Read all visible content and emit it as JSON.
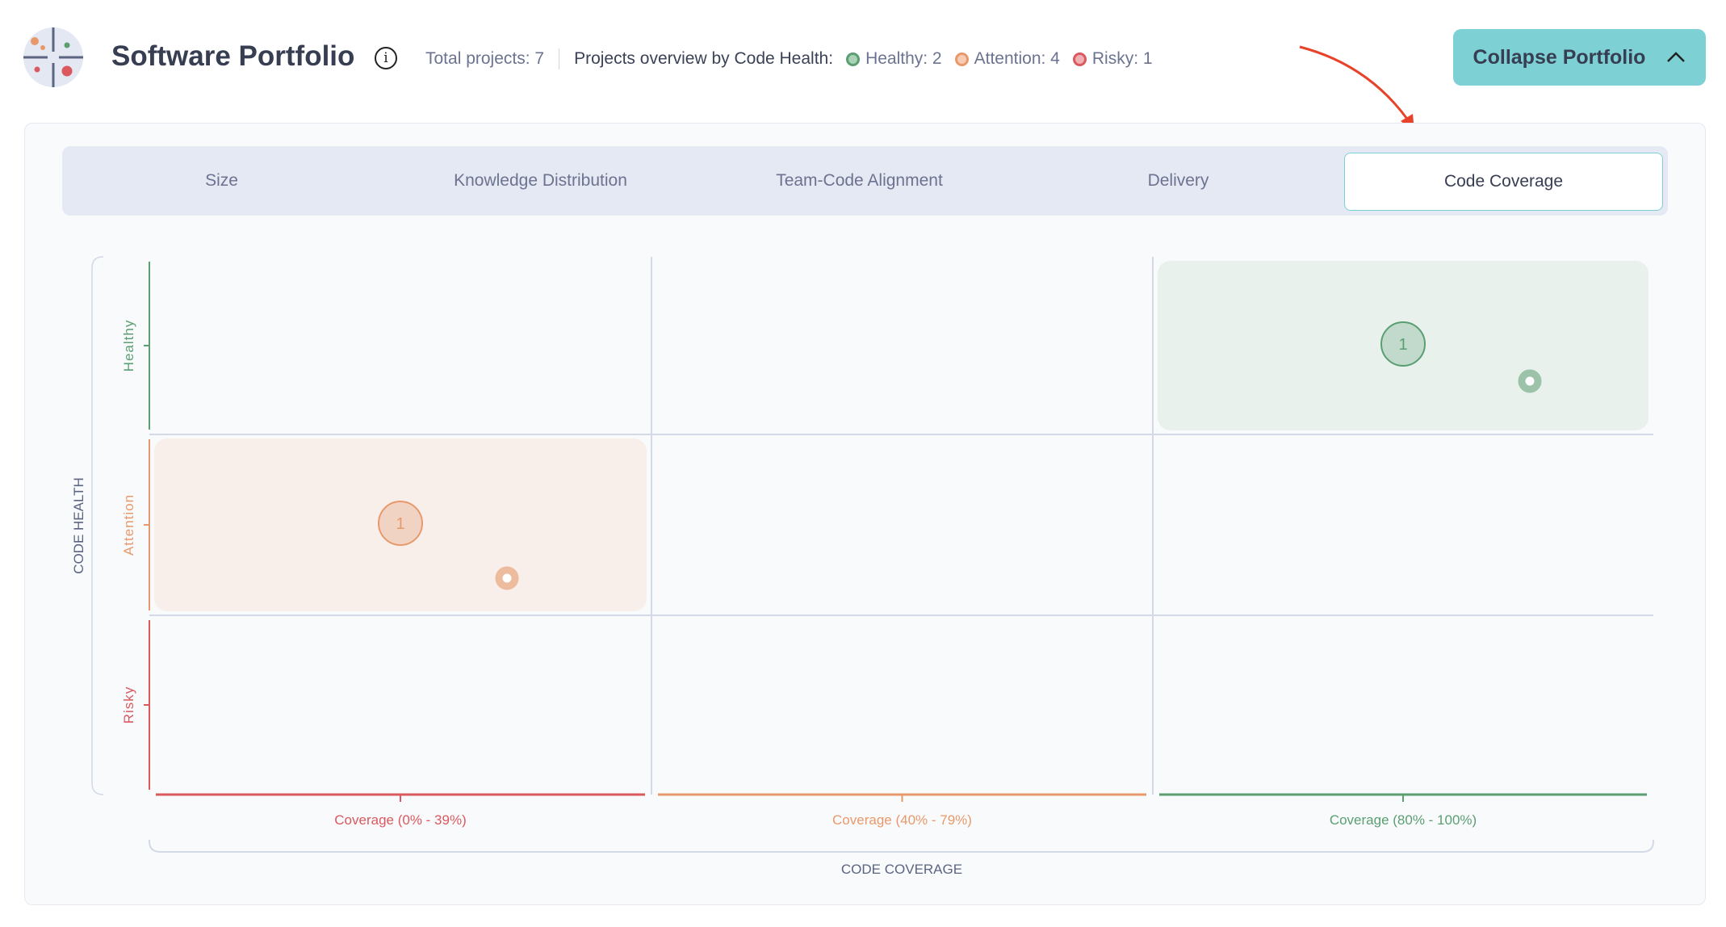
{
  "header": {
    "title": "Software Portfolio",
    "info_icon": "info-circle-icon",
    "total_projects": "Total projects: 7",
    "overview_label": "Projects overview by Code Health:",
    "health_counts": [
      {
        "label": "Healthy: 2",
        "color": "#5a9e72"
      },
      {
        "label": "Attention: 4",
        "color": "#e8996b"
      },
      {
        "label": "Risky: 1",
        "color": "#d9595f"
      }
    ],
    "collapse_button": "Collapse Portfolio",
    "collapse_icon": "chevron-up-icon"
  },
  "tabs": [
    {
      "label": "Size",
      "active": false
    },
    {
      "label": "Knowledge Distribution",
      "active": false
    },
    {
      "label": "Team-Code Alignment",
      "active": false
    },
    {
      "label": "Delivery",
      "active": false
    },
    {
      "label": "Code Coverage",
      "active": true
    }
  ],
  "chart_data": {
    "type": "scatter",
    "xlabel": "CODE COVERAGE",
    "ylabel": "CODE HEALTH",
    "x_categories": [
      "Coverage (0% - 39%)",
      "Coverage (40% - 79%)",
      "Coverage (80% - 100%)"
    ],
    "y_categories": [
      "Healthy",
      "Attention",
      "Risky"
    ],
    "colors": {
      "Healthy": "#5a9e72",
      "Attention": "#e8996b",
      "Risky": "#d9595f"
    },
    "x_colors": [
      "#d9595f",
      "#e8996b",
      "#5a9e72"
    ],
    "clusters": [
      {
        "x": "Coverage (80% - 100%)",
        "y": "Healthy",
        "count": "1"
      },
      {
        "x": "Coverage (0% - 39%)",
        "y": "Attention",
        "count": "1"
      }
    ]
  }
}
